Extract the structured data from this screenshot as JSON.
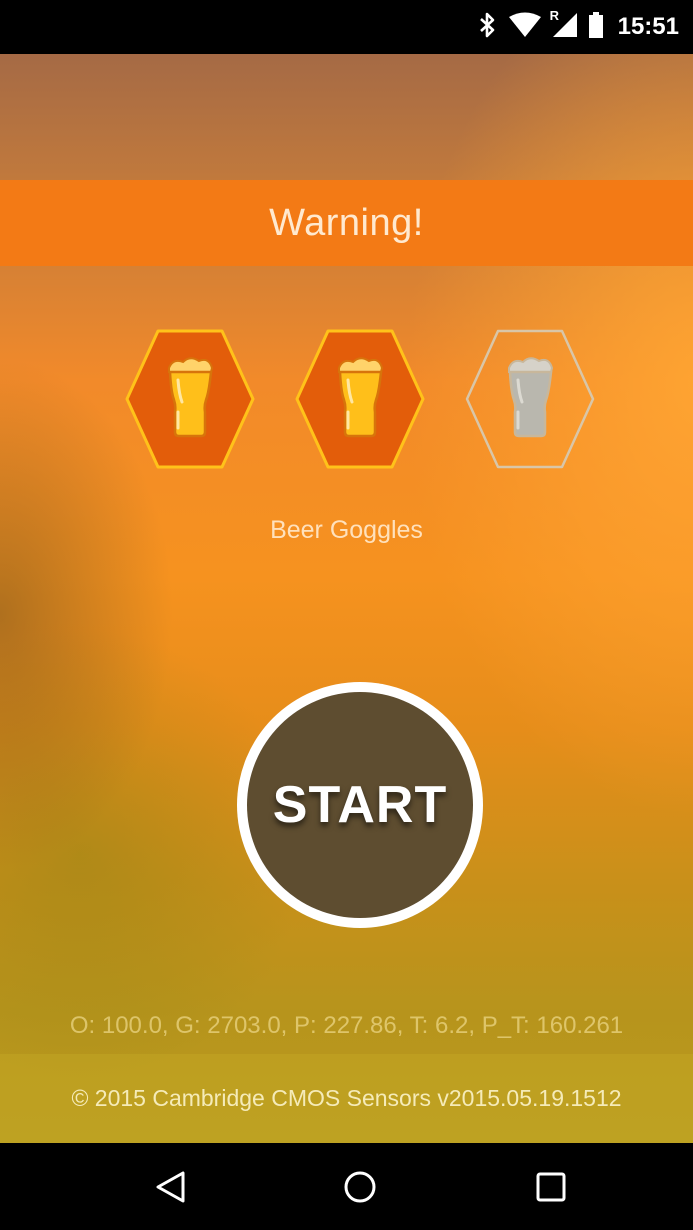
{
  "status_bar": {
    "time": "15:51",
    "network_indicator": "R",
    "icons": [
      "bluetooth-icon",
      "wifi-icon",
      "cellular-signal-icon",
      "battery-icon"
    ]
  },
  "warning": {
    "text": "Warning!"
  },
  "level": {
    "label": "Beer Goggles",
    "filled": 2,
    "total": 3,
    "icon": "beer-glass-icon"
  },
  "start_button": {
    "label": "START"
  },
  "sensor_readout": "O: 100.0, G: 2703.0, P: 227.86, T: 6.2, P_T: 160.261",
  "footer": {
    "copyright": "© 2015 Cambridge CMOS Sensors v2015.05.19.1512"
  },
  "nav_bar": {
    "buttons": [
      "back-icon",
      "home-icon",
      "recents-icon"
    ]
  },
  "colors": {
    "banner": "#f37a15",
    "badge_active_fill": "#e35d0a",
    "badge_active_outline": "#ffc21a",
    "badge_inactive_outline": "#d9c6a8",
    "start_fill": "#5e4d30"
  }
}
